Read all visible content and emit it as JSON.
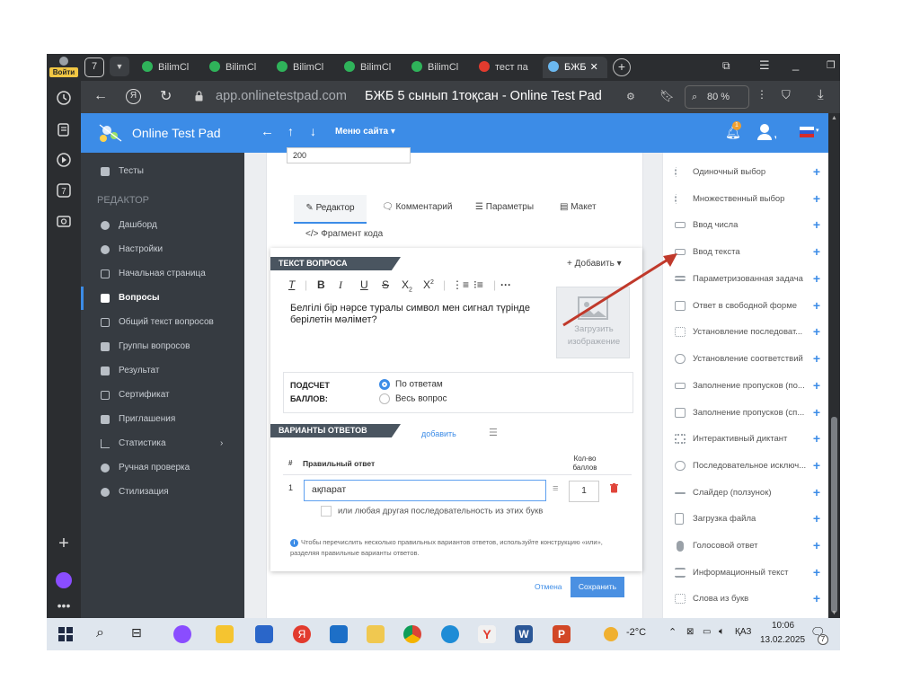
{
  "browser": {
    "login_label": "Войти",
    "tab_count": "7",
    "tabs": [
      {
        "label": "BilimCl"
      },
      {
        "label": "BilimCl"
      },
      {
        "label": "BilimCl"
      },
      {
        "label": "BilimCl"
      },
      {
        "label": "BilimCl"
      },
      {
        "label": "тест па"
      },
      {
        "label": "БЖБ"
      }
    ],
    "url": "app.onlinetestpad.com",
    "page_title": "БЖБ 5 сынып 1тоқсан - Online Test Pad",
    "zoom": "80 %"
  },
  "site": {
    "logo_text": "Online Test Pad",
    "menu_label": "Меню сайта",
    "notification_count": "1"
  },
  "sidebar": {
    "tests_label": "Тесты",
    "section_label": "РЕДАКТОР",
    "items": [
      {
        "label": "Дашборд"
      },
      {
        "label": "Настройки"
      },
      {
        "label": "Начальная страница"
      },
      {
        "label": "Вопросы"
      },
      {
        "label": "Общий текст вопросов"
      },
      {
        "label": "Группы вопросов"
      },
      {
        "label": "Результат"
      },
      {
        "label": "Сертификат"
      },
      {
        "label": "Приглашения"
      },
      {
        "label": "Статистика"
      },
      {
        "label": "Ручная проверка"
      },
      {
        "label": "Стилизация"
      }
    ]
  },
  "editor": {
    "top_input_value": "200",
    "tabs": [
      {
        "label": "Редактор"
      },
      {
        "label": "Комментарий"
      },
      {
        "label": "Параметры"
      },
      {
        "label": "Макет"
      },
      {
        "label": "Фрагмент кода"
      }
    ],
    "question_section_label": "ТЕКСТ ВОПРОСА",
    "add_label": "Добавить",
    "question_text": "Белгілі бір нәрсе туралы символ мен сигнал түрінде берілетін мәлімет?",
    "upload_label": "Загрузить изображение",
    "scoring_label": "ПОДСЧЕТ БАЛЛОВ:",
    "scoring_options": [
      {
        "label": "По ответам",
        "checked": true
      },
      {
        "label": "Весь вопрос",
        "checked": false
      }
    ],
    "answers_section_label": "ВАРИАНТЫ ОТВЕТОВ",
    "add_answer_label": "добавить",
    "col_num": "#",
    "col_answer": "Правильный ответ",
    "col_points": "Кол-во баллов",
    "answer_row": {
      "num": "1",
      "value": "ақпарат",
      "points": "1"
    },
    "any_sequence_label": "или любая другая последовательность из этих букв",
    "hint_text": "Чтобы перечислить несколько правильных вариантов ответов, используйте конструкцию «или», разделяя правильные варианты ответов.",
    "cancel_label": "Отмена",
    "save_label": "Сохранить"
  },
  "question_types": [
    {
      "label": "Одиночный выбор"
    },
    {
      "label": "Множественный выбор"
    },
    {
      "label": "Ввод числа"
    },
    {
      "label": "Ввод текста"
    },
    {
      "label": "Параметризованная задача"
    },
    {
      "label": "Ответ в свободной форме"
    },
    {
      "label": "Установление последоват..."
    },
    {
      "label": "Установление соответствий"
    },
    {
      "label": "Заполнение пропусков (по..."
    },
    {
      "label": "Заполнение пропусков (сп..."
    },
    {
      "label": "Интерактивный диктант"
    },
    {
      "label": "Последовательное исключ..."
    },
    {
      "label": "Слайдер (ползунок)"
    },
    {
      "label": "Загрузка файла"
    },
    {
      "label": "Голосовой ответ"
    },
    {
      "label": "Информационный текст"
    },
    {
      "label": "Слова из букв"
    }
  ],
  "taskbar": {
    "weather": "-2°C",
    "language": "ҚАЗ",
    "time": "10:06",
    "date": "13.02.2025",
    "notif_count": "7"
  },
  "colors": {
    "accent": "#3c8ce7",
    "sidebar_bg": "#363b41",
    "browser_bg": "#2b2d30",
    "arrow": "#c0392b"
  }
}
